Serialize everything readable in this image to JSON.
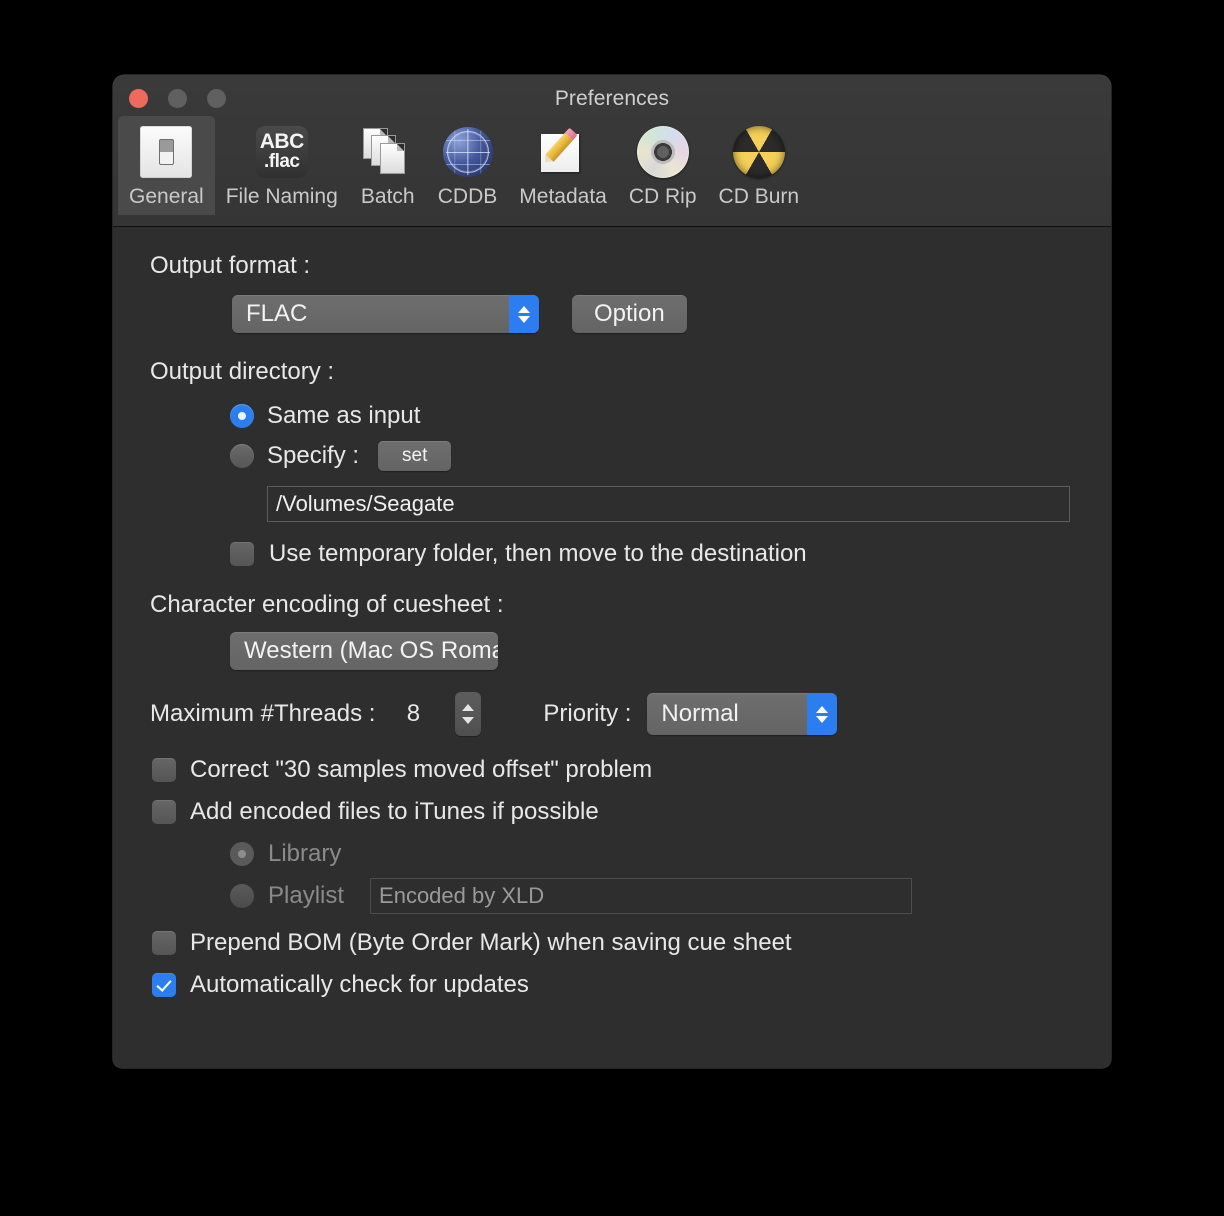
{
  "window": {
    "title": "Preferences",
    "traffic_lights": [
      "close",
      "minimize",
      "zoom"
    ],
    "accent_color": "#2c7ef0",
    "background_color": "#2e2e2e"
  },
  "toolbar": {
    "tabs": [
      {
        "label": "General",
        "icon": "toggle-switch-icon",
        "selected": true
      },
      {
        "label": "File Naming",
        "icon": "abc-flac-icon",
        "selected": false
      },
      {
        "label": "Batch",
        "icon": "documents-stack-icon",
        "selected": false
      },
      {
        "label": "CDDB",
        "icon": "globe-icon",
        "selected": false
      },
      {
        "label": "Metadata",
        "icon": "pencil-note-icon",
        "selected": false
      },
      {
        "label": "CD Rip",
        "icon": "compact-disc-icon",
        "selected": false
      },
      {
        "label": "CD Burn",
        "icon": "burn-disc-icon",
        "selected": false
      }
    ],
    "flac_icon_line1": "ABC",
    "flac_icon_line2": ".flac"
  },
  "general": {
    "output_format_label": "Output format :",
    "output_format_value": "FLAC",
    "option_button": "Option",
    "output_directory_label": "Output directory :",
    "same_as_input_label": "Same as input",
    "same_as_input_selected": true,
    "specify_label": "Specify :",
    "specify_selected": false,
    "set_button": "set",
    "path_value": "/Volumes/Seagate",
    "temp_folder_label": "Use temporary folder, then move to the destination",
    "temp_folder_checked": false,
    "cuesheet_encoding_label": "Character encoding of cuesheet :",
    "cuesheet_encoding_value": "Western (Mac OS Roman)",
    "max_threads_label": "Maximum #Threads :",
    "max_threads_value": "8",
    "priority_label": "Priority :",
    "priority_value": "Normal",
    "correct_offset_label": "Correct \"30 samples moved offset\" problem",
    "correct_offset_checked": false,
    "add_itunes_label": "Add encoded files to iTunes if possible",
    "add_itunes_checked": false,
    "library_label": "Library",
    "library_selected": true,
    "library_enabled": false,
    "playlist_label": "Playlist",
    "playlist_selected": false,
    "playlist_enabled": false,
    "playlist_value": "Encoded by XLD",
    "prepend_bom_label": "Prepend BOM (Byte Order Mark) when saving cue sheet",
    "prepend_bom_checked": false,
    "auto_update_label": "Automatically check for updates",
    "auto_update_checked": true
  }
}
